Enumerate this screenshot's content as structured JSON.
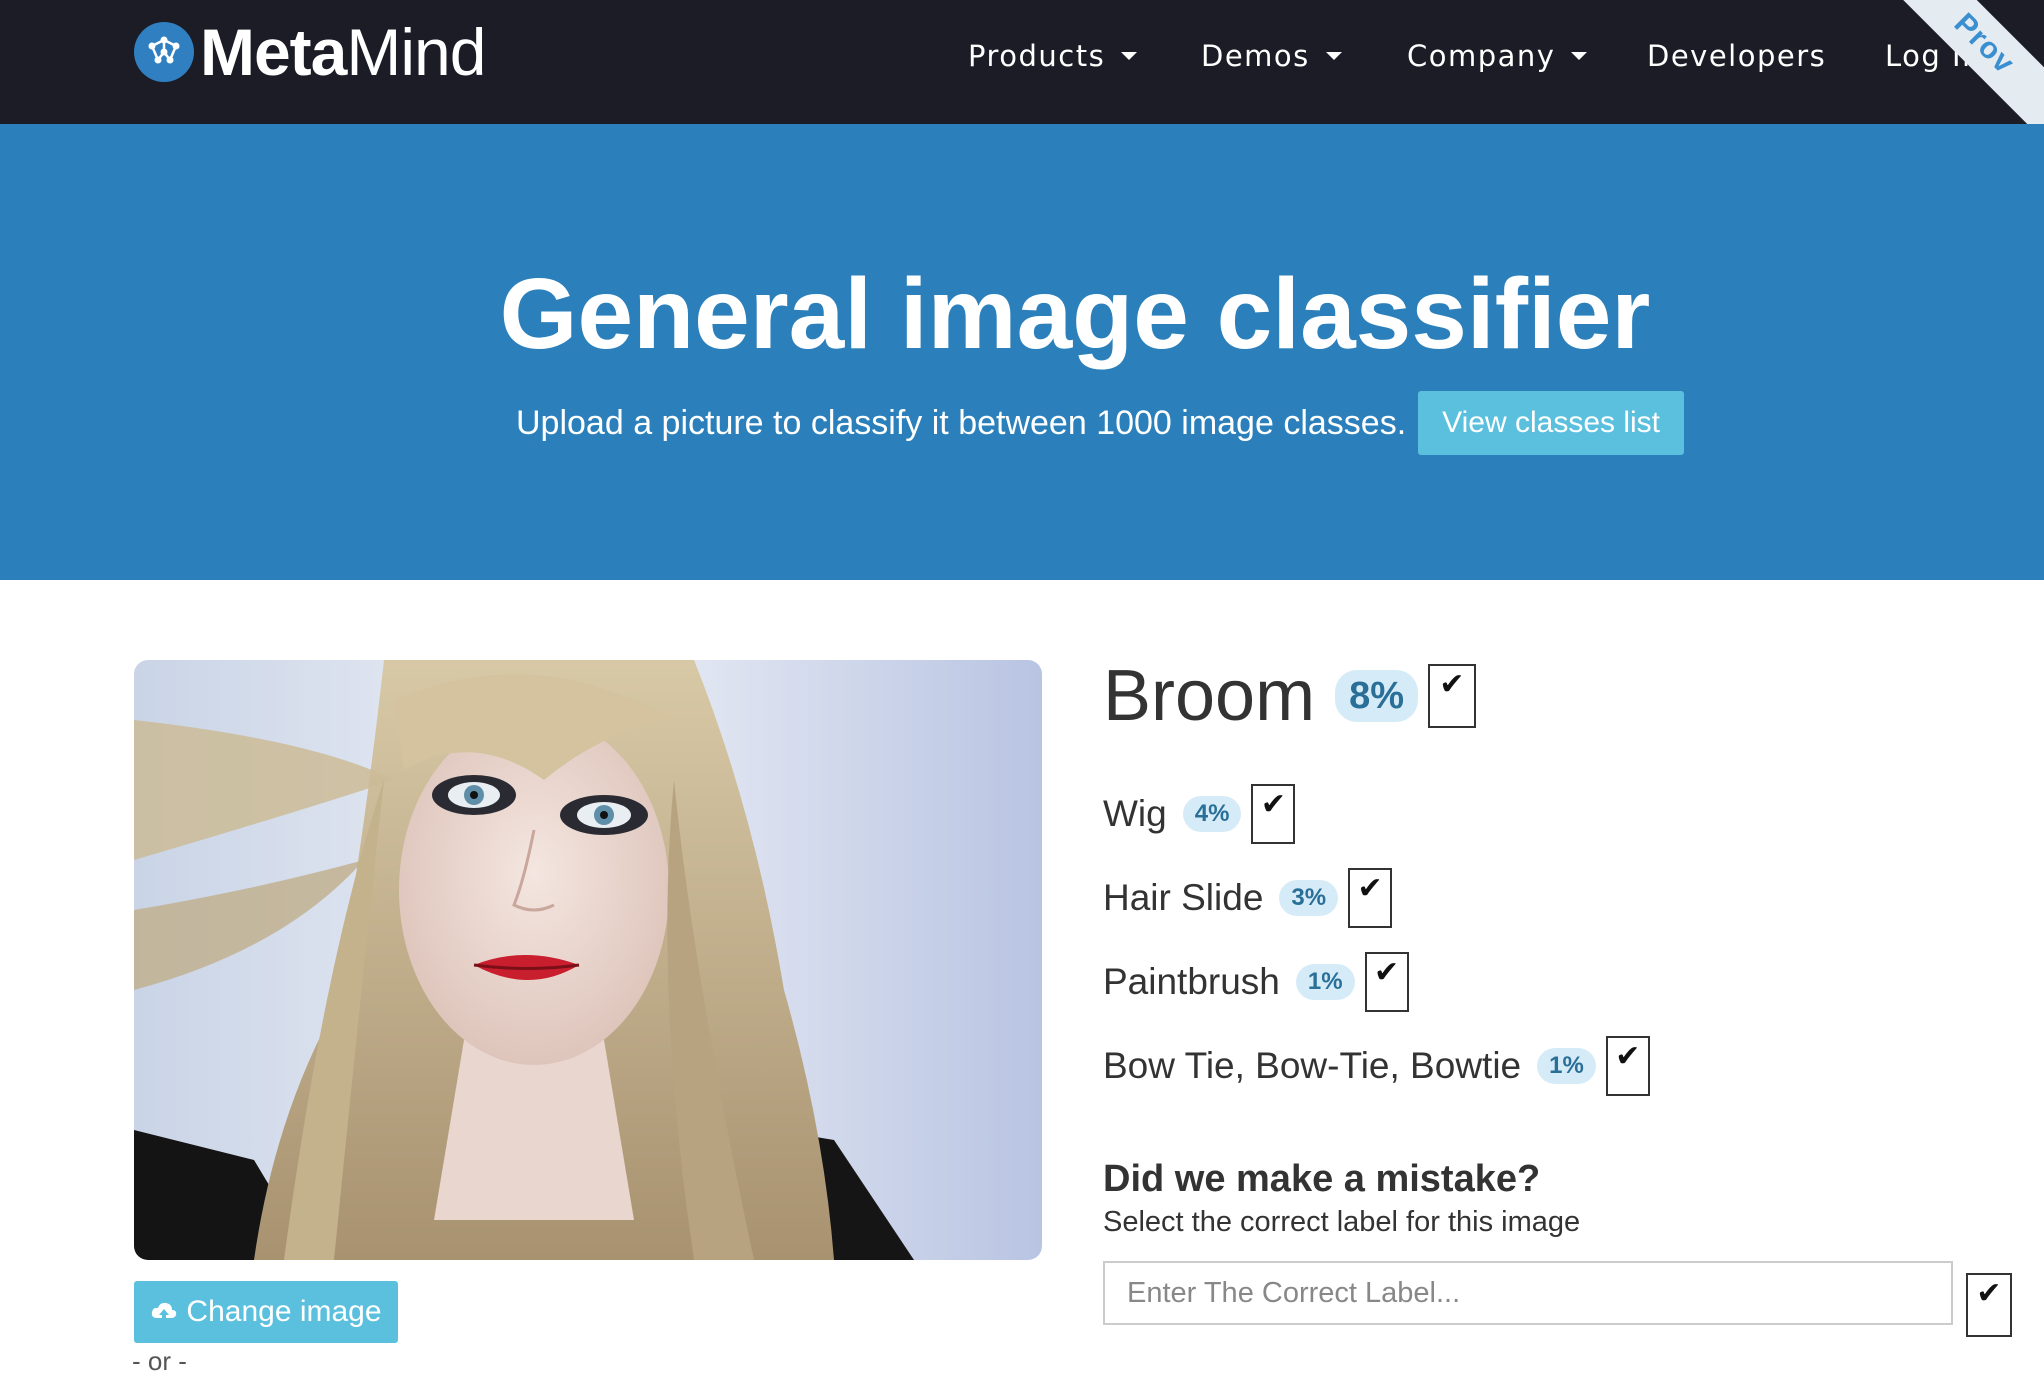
{
  "brand": {
    "name_bold": "Meta",
    "name_light": "Mind"
  },
  "nav": {
    "products": "Products",
    "demos": "Demos",
    "company": "Company",
    "developers": "Developers",
    "login": "Log In",
    "ribbon": "Prov"
  },
  "hero": {
    "title": "General image classifier",
    "subtitle": "Upload a picture to classify it between 1000 image classes.",
    "classes_button": "View classes list"
  },
  "image_panel": {
    "change_button": "Change image",
    "or_text": "- or -"
  },
  "results": {
    "top": {
      "label": "Broom",
      "percent": "8%"
    },
    "others": [
      {
        "label": "Wig",
        "percent": "4%"
      },
      {
        "label": "Hair Slide",
        "percent": "3%"
      },
      {
        "label": "Paintbrush",
        "percent": "1%"
      },
      {
        "label": "Bow Tie, Bow-Tie, Bowtie",
        "percent": "1%"
      }
    ],
    "check_glyph": "✔"
  },
  "feedback": {
    "title": "Did we make a mistake?",
    "subtitle": "Select the correct label for this image",
    "input_placeholder": "Enter The Correct Label...",
    "input_value": ""
  },
  "colors": {
    "navbar": "#1b1c26",
    "hero": "#2b80bb",
    "button_info": "#5bc0de",
    "badge_bg": "#d5ecf8",
    "badge_text": "#2a6f97"
  }
}
